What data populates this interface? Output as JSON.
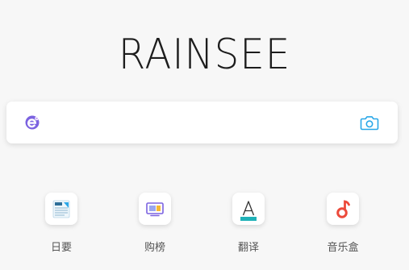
{
  "brand": {
    "title": "RAINSEE"
  },
  "search": {
    "value": "",
    "placeholder": "",
    "engine_icon": "engine-e-icon",
    "camera_icon": "camera-icon",
    "accent_color": "#29a7e8"
  },
  "shortcuts": [
    {
      "label": "日要",
      "icon": "news-icon"
    },
    {
      "label": "购榜",
      "icon": "shopping-rank-icon"
    },
    {
      "label": "翻译",
      "icon": "translate-icon"
    },
    {
      "label": "音乐盒",
      "icon": "music-box-icon"
    }
  ],
  "colors": {
    "background": "#f7f7f7",
    "engine_purple": "#7b62e0",
    "translate_teal": "#1fb1b7",
    "music_red": "#ec4a3b"
  }
}
